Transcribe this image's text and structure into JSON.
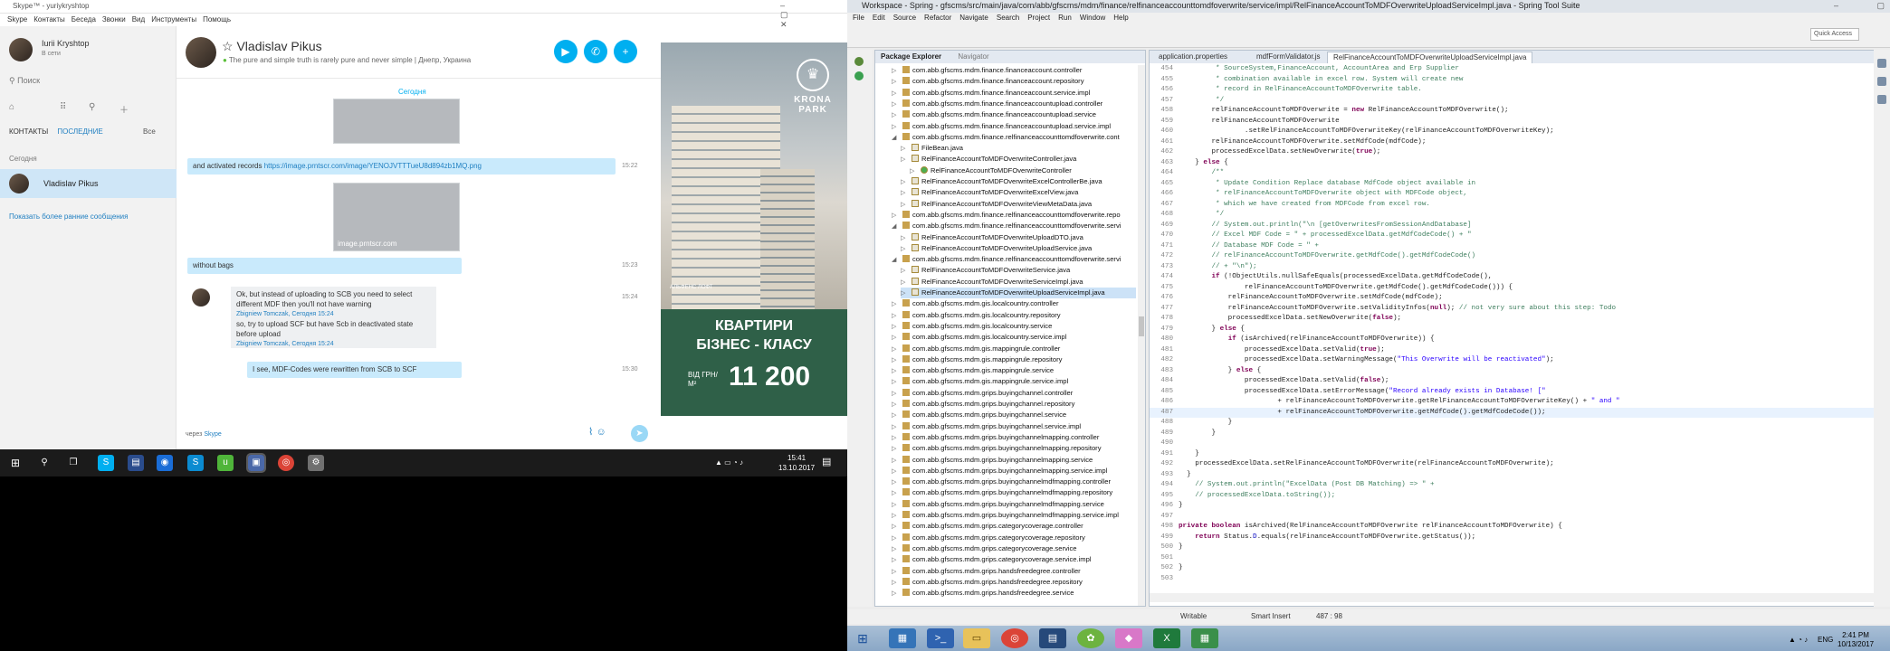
{
  "skype": {
    "window_title": "Skype™ - yuriykryshtop",
    "menu": [
      "Skype",
      "Контакты",
      "Беседа",
      "Звонки",
      "Вид",
      "Инструменты",
      "Помощь"
    ],
    "user": {
      "name": "Iurii Kryshtop",
      "status": "В сети"
    },
    "search_placeholder": "Поиск",
    "tabs": {
      "contacts": "КОНТАКТЫ",
      "recent": "ПОСЛЕДНИЕ",
      "all": "Все"
    },
    "today_label": "Сегодня",
    "recent_contact": "Vladislav Pikus",
    "show_older": "Показать более ранние сообщения",
    "chat": {
      "name": "Vladislav Pikus",
      "mood": "The pure and simple truth is rarely pure and never simple | Днепр, Украина",
      "day": "Сегодня",
      "messages": [
        {
          "text_prefix": "and activated records ",
          "link": "https://image.prntscr.com/image/YENOJVTTTueU8d894zb1MQ.png",
          "time": "15:22"
        },
        {
          "image_caption": "image.prntscr.com"
        },
        {
          "text": "without bags",
          "time": "15:23"
        },
        {
          "quote": "Ok, but instead of uploading to SCB you need to select different MDF then you'll not have warning",
          "author": "Zbigniew Tomczak, Сегодня 15:24",
          "time": "15:24"
        },
        {
          "quote": "so, try to upload SCF but have Scb in deactivated state before upload",
          "author": "Zbigniew Tomczak, Сегодня 15:24"
        },
        {
          "text": "I see, MDF-Codes were rewritten from SCB to SCF",
          "time": "15:30"
        }
      ],
      "via_prefix": "через ",
      "via_link": "Skype"
    },
    "ad": {
      "brand": "KRONA PARK",
      "developer": "АЛЬФЕНС ЛОФТ",
      "line1": "КВАРТИРИ",
      "line2": "БІЗНЕС - КЛАСУ",
      "from": "ВІД ГРН/М²",
      "price": "11 200"
    }
  },
  "taskbar_win10": {
    "time": "15:41",
    "date": "13.10.2017"
  },
  "eclipse": {
    "title": "Workspace - Spring - gfscms/src/main/java/com/abb/gfscms/mdm/finance/relfinanceaccounttomdfoverwrite/service/impl/RelFinanceAccountToMDFOverwriteUploadServiceImpl.java - Spring Tool Suite",
    "menu": [
      "File",
      "Edit",
      "Source",
      "Refactor",
      "Navigate",
      "Search",
      "Project",
      "Run",
      "Window",
      "Help"
    ],
    "quick_access": "Quick Access",
    "explorer_tabs": [
      "Package Explorer",
      "Navigator"
    ],
    "tree": [
      {
        "t": "com.abb.gfscms.mdm.finance.financeaccount.controller",
        "k": "p",
        "i": 0
      },
      {
        "t": "com.abb.gfscms.mdm.finance.financeaccount.repository",
        "k": "p",
        "i": 0
      },
      {
        "t": "com.abb.gfscms.mdm.finance.financeaccount.service.impl",
        "k": "p",
        "i": 0
      },
      {
        "t": "com.abb.gfscms.mdm.finance.financeaccountupload.controller",
        "k": "p",
        "i": 0
      },
      {
        "t": "com.abb.gfscms.mdm.finance.financeaccountupload.service",
        "k": "p",
        "i": 0
      },
      {
        "t": "com.abb.gfscms.mdm.finance.financeaccountupload.service.impl",
        "k": "p",
        "i": 0
      },
      {
        "t": "com.abb.gfscms.mdm.finance.relfinanceaccounttomdfoverwrite.cont",
        "k": "p",
        "i": 0,
        "open": true
      },
      {
        "t": "FileBean.java",
        "k": "f",
        "i": 1
      },
      {
        "t": "RelFinanceAccountToMDFOverwriteController.java",
        "k": "f",
        "i": 1
      },
      {
        "t": "RelFinanceAccountToMDFOverwriteController",
        "k": "c",
        "i": 2
      },
      {
        "t": "RelFinanceAccountToMDFOverwriteExcelControllerBe.java",
        "k": "f",
        "i": 1
      },
      {
        "t": "RelFinanceAccountToMDFOverwriteExcelView.java",
        "k": "f",
        "i": 1
      },
      {
        "t": "RelFinanceAccountToMDFOverwriteViewMetaData.java",
        "k": "f",
        "i": 1
      },
      {
        "t": "com.abb.gfscms.mdm.finance.relfinanceaccounttomdfoverwrite.repo",
        "k": "p",
        "i": 0
      },
      {
        "t": "com.abb.gfscms.mdm.finance.relfinanceaccounttomdfoverwrite.servi",
        "k": "p",
        "i": 0,
        "open": true
      },
      {
        "t": "RelFinanceAccountToMDFOverwriteUploadDTO.java",
        "k": "f",
        "i": 1
      },
      {
        "t": "RelFinanceAccountToMDFOverwriteUploadService.java",
        "k": "f",
        "i": 1
      },
      {
        "t": "com.abb.gfscms.mdm.finance.relfinanceaccounttomdfoverwrite.servi",
        "k": "p",
        "i": 0,
        "open": true
      },
      {
        "t": "RelFinanceAccountToMDFOverwriteService.java",
        "k": "f",
        "i": 1
      },
      {
        "t": "RelFinanceAccountToMDFOverwriteServiceImpl.java",
        "k": "f",
        "i": 1
      },
      {
        "t": "RelFinanceAccountToMDFOverwriteUploadServiceImpl.java",
        "k": "f",
        "i": 1,
        "sel": true
      },
      {
        "t": "com.abb.gfscms.mdm.gis.localcountry.controller",
        "k": "p",
        "i": 0
      },
      {
        "t": "com.abb.gfscms.mdm.gis.localcountry.repository",
        "k": "p",
        "i": 0
      },
      {
        "t": "com.abb.gfscms.mdm.gis.localcountry.service",
        "k": "p",
        "i": 0
      },
      {
        "t": "com.abb.gfscms.mdm.gis.localcountry.service.impl",
        "k": "p",
        "i": 0
      },
      {
        "t": "com.abb.gfscms.mdm.gis.mappingrule.controller",
        "k": "p",
        "i": 0
      },
      {
        "t": "com.abb.gfscms.mdm.gis.mappingrule.repository",
        "k": "p",
        "i": 0
      },
      {
        "t": "com.abb.gfscms.mdm.gis.mappingrule.service",
        "k": "p",
        "i": 0
      },
      {
        "t": "com.abb.gfscms.mdm.gis.mappingrule.service.impl",
        "k": "p",
        "i": 0
      },
      {
        "t": "com.abb.gfscms.mdm.grips.buyingchannel.controller",
        "k": "p",
        "i": 0
      },
      {
        "t": "com.abb.gfscms.mdm.grips.buyingchannel.repository",
        "k": "p",
        "i": 0
      },
      {
        "t": "com.abb.gfscms.mdm.grips.buyingchannel.service",
        "k": "p",
        "i": 0
      },
      {
        "t": "com.abb.gfscms.mdm.grips.buyingchannel.service.impl",
        "k": "p",
        "i": 0
      },
      {
        "t": "com.abb.gfscms.mdm.grips.buyingchannelmapping.controller",
        "k": "p",
        "i": 0
      },
      {
        "t": "com.abb.gfscms.mdm.grips.buyingchannelmapping.repository",
        "k": "p",
        "i": 0
      },
      {
        "t": "com.abb.gfscms.mdm.grips.buyingchannelmapping.service",
        "k": "p",
        "i": 0
      },
      {
        "t": "com.abb.gfscms.mdm.grips.buyingchannelmapping.service.impl",
        "k": "p",
        "i": 0
      },
      {
        "t": "com.abb.gfscms.mdm.grips.buyingchannelmdfmapping.controller",
        "k": "p",
        "i": 0
      },
      {
        "t": "com.abb.gfscms.mdm.grips.buyingchannelmdfmapping.repository",
        "k": "p",
        "i": 0
      },
      {
        "t": "com.abb.gfscms.mdm.grips.buyingchannelmdfmapping.service",
        "k": "p",
        "i": 0
      },
      {
        "t": "com.abb.gfscms.mdm.grips.buyingchannelmdfmapping.service.impl",
        "k": "p",
        "i": 0
      },
      {
        "t": "com.abb.gfscms.mdm.grips.categorycoverage.controller",
        "k": "p",
        "i": 0
      },
      {
        "t": "com.abb.gfscms.mdm.grips.categorycoverage.repository",
        "k": "p",
        "i": 0
      },
      {
        "t": "com.abb.gfscms.mdm.grips.categorycoverage.service",
        "k": "p",
        "i": 0
      },
      {
        "t": "com.abb.gfscms.mdm.grips.categorycoverage.service.impl",
        "k": "p",
        "i": 0
      },
      {
        "t": "com.abb.gfscms.mdm.grips.handsfreedegree.controller",
        "k": "p",
        "i": 0
      },
      {
        "t": "com.abb.gfscms.mdm.grips.handsfreedegree.repository",
        "k": "p",
        "i": 0
      },
      {
        "t": "com.abb.gfscms.mdm.grips.handsfreedegree.service",
        "k": "p",
        "i": 0
      }
    ],
    "editor_tabs": [
      "application.properties",
      "mdfFormValidator.js",
      "RelFinanceAccountToMDFOverwriteUploadServiceImpl.java"
    ],
    "code": [
      {
        "n": "454",
        "s": [
          [
            "cm",
            "         * SourceSystem,FinanceAccount, AccountArea and Erp Supplier"
          ]
        ]
      },
      {
        "n": "455",
        "s": [
          [
            "cm",
            "         * combination available in excel row. System will create new"
          ]
        ]
      },
      {
        "n": "456",
        "s": [
          [
            "cm",
            "         * record in RelFinanceAccountToMDFOverwrite table."
          ]
        ]
      },
      {
        "n": "457",
        "s": [
          [
            "cm",
            "         */"
          ]
        ]
      },
      {
        "n": "458",
        "s": [
          [
            "",
            "        relFinanceAccountToMDFOverwrite = "
          ],
          [
            "kw",
            "new"
          ],
          [
            "",
            " RelFinanceAccountToMDFOverwrite();"
          ]
        ]
      },
      {
        "n": "459",
        "s": [
          [
            "",
            "        relFinanceAccountToMDFOverwrite"
          ]
        ]
      },
      {
        "n": "460",
        "s": [
          [
            "",
            "                .setRelFinanceAccountToMDFOverwriteKey(relFinanceAccountToMDFOverwriteKey);"
          ]
        ]
      },
      {
        "n": "461",
        "s": [
          [
            "",
            "        relFinanceAccountToMDFOverwrite.setMdfCode(mdfCode);"
          ]
        ]
      },
      {
        "n": "462",
        "s": [
          [
            "",
            "        processedExcelData.setNewOverwrite("
          ],
          [
            "kw",
            "true"
          ],
          [
            "",
            ");"
          ]
        ]
      },
      {
        "n": "463",
        "s": [
          [
            "",
            "    } "
          ],
          [
            "kw",
            "else"
          ],
          [
            "",
            " {"
          ]
        ]
      },
      {
        "n": "464",
        "s": [
          [
            "cm",
            "        /**"
          ]
        ]
      },
      {
        "n": "465",
        "s": [
          [
            "cm",
            "         * Update Condition Replace database MdfCode object available in"
          ]
        ]
      },
      {
        "n": "466",
        "s": [
          [
            "cm",
            "         * relFinanceAccountToMDFOverwrite object with MDFCode object,"
          ]
        ]
      },
      {
        "n": "467",
        "s": [
          [
            "cm",
            "         * which we have created from MDFCode from excel row."
          ]
        ]
      },
      {
        "n": "468",
        "s": [
          [
            "cm",
            "         */"
          ]
        ]
      },
      {
        "n": "469",
        "s": [
          [
            "cm",
            "        // System.out.println(\"\\n [getOverwritesFromSessionAndDatabase]"
          ]
        ]
      },
      {
        "n": "470",
        "s": [
          [
            "cm",
            "        // Excel MDF Code = \" + processedExcelData.getMdfCodeCode() + \""
          ]
        ]
      },
      {
        "n": "471",
        "s": [
          [
            "cm",
            "        // Database MDF Code = \" +"
          ]
        ]
      },
      {
        "n": "472",
        "s": [
          [
            "cm",
            "        // relFinanceAccountToMDFOverwrite.getMdfCode().getMdfCodeCode()"
          ]
        ]
      },
      {
        "n": "473",
        "s": [
          [
            "cm",
            "        // + \"\\n\");"
          ]
        ]
      },
      {
        "n": "474",
        "s": [
          [
            "",
            "        "
          ],
          [
            "kw",
            "if"
          ],
          [
            "",
            " (!ObjectUtils.nullSafeEquals(processedExcelData.getMdfCodeCode(),"
          ]
        ]
      },
      {
        "n": "475",
        "s": [
          [
            "",
            "                relFinanceAccountToMDFOverwrite.getMdfCode().getMdfCodeCode())) {"
          ]
        ]
      },
      {
        "n": "476",
        "s": [
          [
            "",
            "            relFinanceAccountToMDFOverwrite.setMdfCode(mdfCode);"
          ]
        ]
      },
      {
        "n": "477",
        "s": [
          [
            "",
            "            relFinanceAccountToMDFOverwrite.setValidityInfos("
          ],
          [
            "kw",
            "null"
          ],
          [
            "",
            "); "
          ],
          [
            "cm",
            "// not very sure about this step: Todo"
          ]
        ]
      },
      {
        "n": "478",
        "s": [
          [
            "",
            "            processedExcelData.setNewOverwrite("
          ],
          [
            "kw",
            "false"
          ],
          [
            "",
            ");"
          ]
        ]
      },
      {
        "n": "479",
        "s": [
          [
            "",
            "        } "
          ],
          [
            "kw",
            "else"
          ],
          [
            "",
            " {"
          ]
        ]
      },
      {
        "n": "480",
        "s": [
          [
            "",
            "            "
          ],
          [
            "kw",
            "if"
          ],
          [
            "",
            " (isArchived(relFinanceAccountToMDFOverwrite)) {"
          ]
        ]
      },
      {
        "n": "481",
        "s": [
          [
            "",
            "                processedExcelData.setValid("
          ],
          [
            "kw",
            "true"
          ],
          [
            "",
            ");"
          ]
        ]
      },
      {
        "n": "482",
        "s": [
          [
            "",
            "                processedExcelData.setWarningMessage("
          ],
          [
            "st",
            "\"This Overwrite will be reactivated\""
          ],
          [
            "",
            ");"
          ]
        ]
      },
      {
        "n": "483",
        "s": [
          [
            "",
            "            } "
          ],
          [
            "kw",
            "else"
          ],
          [
            "",
            " {"
          ]
        ]
      },
      {
        "n": "484",
        "s": [
          [
            "",
            "                processedExcelData.setValid("
          ],
          [
            "kw",
            "false"
          ],
          [
            "",
            ");"
          ]
        ]
      },
      {
        "n": "485",
        "s": [
          [
            "",
            "                processedExcelData.setErrorMessage("
          ],
          [
            "st",
            "\"Record already exists in Database! [\""
          ]
        ]
      },
      {
        "n": "486",
        "s": [
          [
            "",
            "                        + relFinanceAccountToMDFOverwrite.getRelFinanceAccountToMDFOverwriteKey() + "
          ],
          [
            "st",
            "\" and \""
          ]
        ]
      },
      {
        "n": "487",
        "s": [
          [
            "",
            "                        + relFinanceAccountToMDFOverwrite.getMdfCode().getMdfCodeCode());"
          ]
        ],
        "cur": true
      },
      {
        "n": "488",
        "s": [
          [
            "",
            "            }"
          ]
        ]
      },
      {
        "n": "489",
        "s": [
          [
            "",
            "        }"
          ]
        ]
      },
      {
        "n": "490",
        "s": [
          [
            "",
            ""
          ]
        ]
      },
      {
        "n": "491",
        "s": [
          [
            "",
            "    }"
          ]
        ]
      },
      {
        "n": "492",
        "s": [
          [
            "",
            "    processedExcelData.setRelFinanceAccountToMDFOverwrite(relFinanceAccountToMDFOverwrite);"
          ]
        ]
      },
      {
        "n": "493",
        "s": [
          [
            "",
            "  }"
          ]
        ]
      },
      {
        "n": "494",
        "s": [
          [
            "cm",
            "    // System.out.println(\"ExcelData (Post DB Matching) => \" +"
          ]
        ]
      },
      {
        "n": "495",
        "s": [
          [
            "cm",
            "    // processedExcelData.toString());"
          ]
        ]
      },
      {
        "n": "496",
        "s": [
          [
            "",
            "}"
          ]
        ]
      },
      {
        "n": "497",
        "s": [
          [
            "",
            ""
          ]
        ]
      },
      {
        "n": "498",
        "s": [
          [
            "kw",
            "private boolean"
          ],
          [
            "",
            " isArchived(RelFinanceAccountToMDFOverwrite relFinanceAccountToMDFOverwrite) {"
          ]
        ]
      },
      {
        "n": "499",
        "s": [
          [
            "",
            "    "
          ],
          [
            "kw",
            "return"
          ],
          [
            "",
            " Status."
          ],
          [
            "fl",
            "D"
          ],
          [
            "",
            ".equals(relFinanceAccountToMDFOverwrite.getStatus());"
          ]
        ]
      },
      {
        "n": "500",
        "s": [
          [
            "",
            "}"
          ]
        ]
      },
      {
        "n": "501",
        "s": [
          [
            "",
            ""
          ]
        ]
      },
      {
        "n": "502",
        "s": [
          [
            "",
            "}"
          ]
        ]
      },
      {
        "n": "503",
        "s": [
          [
            "",
            ""
          ]
        ]
      }
    ],
    "status": {
      "writable": "Writable",
      "insert": "Smart Insert",
      "position": "487 : 98"
    }
  },
  "taskbar_win8": {
    "lang": "ENG",
    "time": "2:41 PM",
    "date": "10/13/2017"
  }
}
